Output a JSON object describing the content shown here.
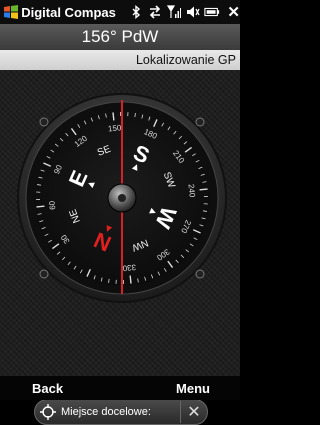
{
  "status_bar": {
    "app_title": "Digital Compas",
    "icons": [
      "windows-start-icon",
      "bluetooth-icon",
      "data-connection-icon",
      "signal-icon",
      "volume-icon",
      "battery-icon",
      "close-icon"
    ]
  },
  "heading": {
    "text": "156° PdW"
  },
  "gps": {
    "status": "Lokalizowanie GP"
  },
  "compass": {
    "cardinals": [
      "N",
      "E",
      "S",
      "W"
    ],
    "intercardinals": [
      "NE",
      "SE",
      "SW",
      "NW"
    ],
    "degree_labels": [
      "30",
      "60",
      "90",
      "120",
      "150",
      "180",
      "210",
      "240",
      "270",
      "300",
      "330"
    ],
    "heading_deg": 156,
    "colors": {
      "needle": "#d8202a",
      "cardinal": "#ffffff",
      "north": "#e02020"
    }
  },
  "destination": {
    "label": "Miejsce docelowe:"
  },
  "softkeys": {
    "left": "Back",
    "right": "Menu"
  }
}
